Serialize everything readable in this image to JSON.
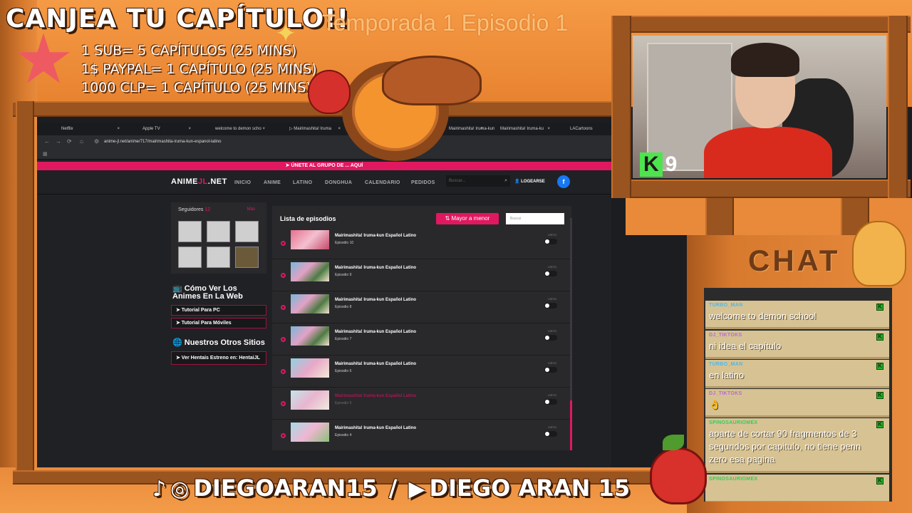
{
  "overlay": {
    "title": "CANJEA TU CAPÍTULO!!",
    "prices": [
      "1 SUB= 5 CAPÍTULOS (25 MINS)",
      "1$ PAYPAL= 1 CAPÍTULO (25 MINS)",
      "1000 CLP= 1 CAPÍTULO (25 MINS)"
    ],
    "season_text": "Temporada 1 Episodio 1",
    "cam_badge_k": "K",
    "cam_badge_num": "9",
    "social_tiktok_ig": "DIEGOARAN15",
    "social_slash": "/",
    "social_youtube": "DIEGO ARAN 15"
  },
  "browser": {
    "tabs": [
      {
        "label": "Netflix",
        "close": "×"
      },
      {
        "label": "Apple TV",
        "close": "×"
      },
      {
        "label": "welcome to demon scho",
        "close": "×"
      },
      {
        "label": "▷ Mairimashita! Iruma",
        "close": "×"
      },
      {
        "label": "Mairimashita! Iruma-kun",
        "close": "×"
      },
      {
        "label": "Mairimashita! Iruma-ku",
        "close": "×"
      },
      {
        "label": "LACartoons",
        "close": "×"
      }
    ],
    "url": "anime-jl.net/anime/717/mairimashita-iruma-kun-espanol-latino"
  },
  "site": {
    "banner": "➤ ÚNETE AL GRUPO DE ... AQUÍ",
    "logo_a": "ANIME",
    "logo_j": "JL",
    "logo_b": ".NET",
    "nav": [
      "INICIO",
      "ANIME",
      "LATINO",
      "DONGHUA",
      "CALENDARIO",
      "PEDIDOS"
    ],
    "search_placeholder": "Buscar...",
    "login": "LOGEARSE",
    "fb": "f",
    "followers_title": "Seguidores",
    "followers_count": "12",
    "followers_more": "Más",
    "howto_title": "📺 Cómo Ver Los Animes En La Web",
    "howto_links": [
      "➤ Tutorial Para PC",
      "➤ Tutorial Para Móviles"
    ],
    "others_title": "🌐 Nuestros Otros Sitios",
    "others_link": "➤ Ver Hentais Estreno en: HentaiJL",
    "episodes_title": "Lista de episodios",
    "order_button": "⇅ Mayor a menor",
    "episode_search_placeholder": "Buscar",
    "visto_label": "VISTO",
    "episodes": [
      {
        "name": "Mairimashita! Iruma-kun Español Latino",
        "sub": "Episodio 10",
        "dim": false
      },
      {
        "name": "Mairimashita! Iruma-kun Español Latino",
        "sub": "Episodio 9",
        "dim": false
      },
      {
        "name": "Mairimashita! Iruma-kun Español Latino",
        "sub": "Episodio 8",
        "dim": false
      },
      {
        "name": "Mairimashita! Iruma-kun Español Latino",
        "sub": "Episodio 7",
        "dim": false
      },
      {
        "name": "Mairimashita! Iruma-kun Español Latino",
        "sub": "Episodio 6",
        "dim": false
      },
      {
        "name": "Mairimashita! Iruma-kun Español Latino",
        "sub": "Episodio 5",
        "dim": true
      },
      {
        "name": "Mairimashita! Iruma-kun Español Latino",
        "sub": "Episodio 4",
        "dim": false
      }
    ]
  },
  "chat": {
    "title": "CHAT",
    "messages": [
      {
        "user": "TURBO_MAN",
        "text": "welcome to demon school",
        "color": "#4fb7e8"
      },
      {
        "user": "DJ_TIKTOKS",
        "text": "ni idea el capítulo",
        "color": "#b26bd8"
      },
      {
        "user": "TURBO_MAN",
        "text": "en latino",
        "color": "#4fb7e8"
      },
      {
        "user": "DJ_TIKTOKS",
        "text": "👌",
        "color": "#b26bd8"
      },
      {
        "user": "SPINOSAURIOMEX",
        "text": "aparte de cortar 90 fragmentos de 3 segundos por capitulo, no tiene penn zero esa pagina",
        "color": "#2fd05a"
      },
      {
        "user": "SPINOSAURIOMEX",
        "text": "",
        "color": "#2fd05a"
      }
    ]
  }
}
